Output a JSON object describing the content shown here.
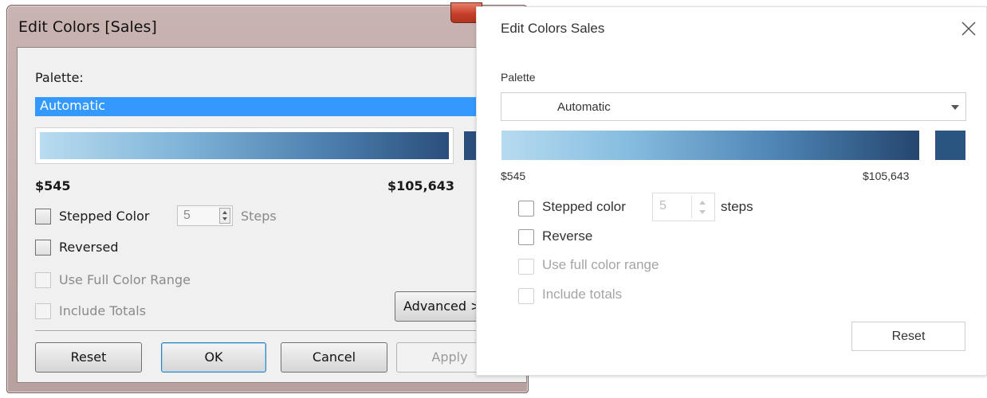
{
  "legacy": {
    "title": "Edit Colors [Sales]",
    "palette_label": "Palette:",
    "palette_value": "Automatic",
    "min_value": "$545",
    "max_value": "$105,643",
    "stepped_label": "Stepped Color",
    "steps_value": "5",
    "steps_label": "Steps",
    "reversed_label": "Reversed",
    "full_range_label": "Use Full Color Range",
    "include_totals_label": "Include Totals",
    "advanced_label": "Advanced >>",
    "reset_label": "Reset",
    "ok_label": "OK",
    "cancel_label": "Cancel",
    "apply_label": "Apply",
    "ramp_start_color": "#b8dcf0",
    "ramp_end_color": "#2b4f7c"
  },
  "modern": {
    "title": "Edit Colors Sales",
    "palette_label": "Palette",
    "palette_value": "Automatic",
    "min_value": "$545",
    "max_value": "$105,643",
    "stepped_label": "Stepped color",
    "steps_value": "5",
    "steps_label": "steps",
    "reverse_label": "Reverse",
    "full_range_label": "Use full color range",
    "include_totals_label": "Include totals",
    "reset_label": "Reset",
    "close_icon": "close-icon",
    "ramp_start_color": "#b6dbf0",
    "ramp_end_color": "#24466f"
  }
}
